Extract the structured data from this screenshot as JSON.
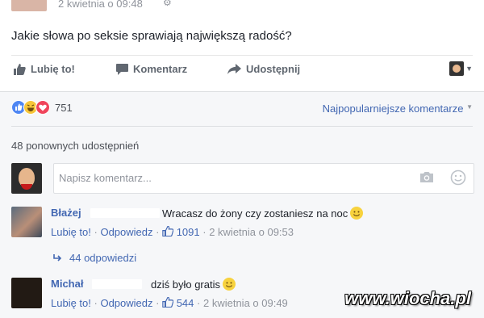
{
  "post": {
    "time": "2 kwietnia o 09:48",
    "text": "Jakie słowa po seksie sprawiają największą radość?"
  },
  "actions": {
    "like": "Lubię to!",
    "comment": "Komentarz",
    "share": "Udostępnij"
  },
  "reactions": {
    "count": "751",
    "sort_label": "Najpopularniejsze komentarze"
  },
  "shares": "48 ponownych udostępnień",
  "comment_input": {
    "placeholder": "Napisz komentarz..."
  },
  "comments": [
    {
      "name": "Błażej",
      "text": "Wracasz do żony czy zostaniesz na noc",
      "like": "Lubię to!",
      "reply": "Odpowiedz",
      "likes": "1091",
      "time": "2 kwietnia o 09:53",
      "replies": "44 odpowiedzi"
    },
    {
      "name": "Michał",
      "text": "dziś było gratis",
      "like": "Lubię to!",
      "reply": "Odpowiedz",
      "likes": "544",
      "time": "2 kwietnia o 09:49"
    }
  ],
  "watermark": "www.wiocha.pl",
  "colors": {
    "link": "#4267b2",
    "muted": "#90949c",
    "background_comments": "#f6f7f9"
  }
}
